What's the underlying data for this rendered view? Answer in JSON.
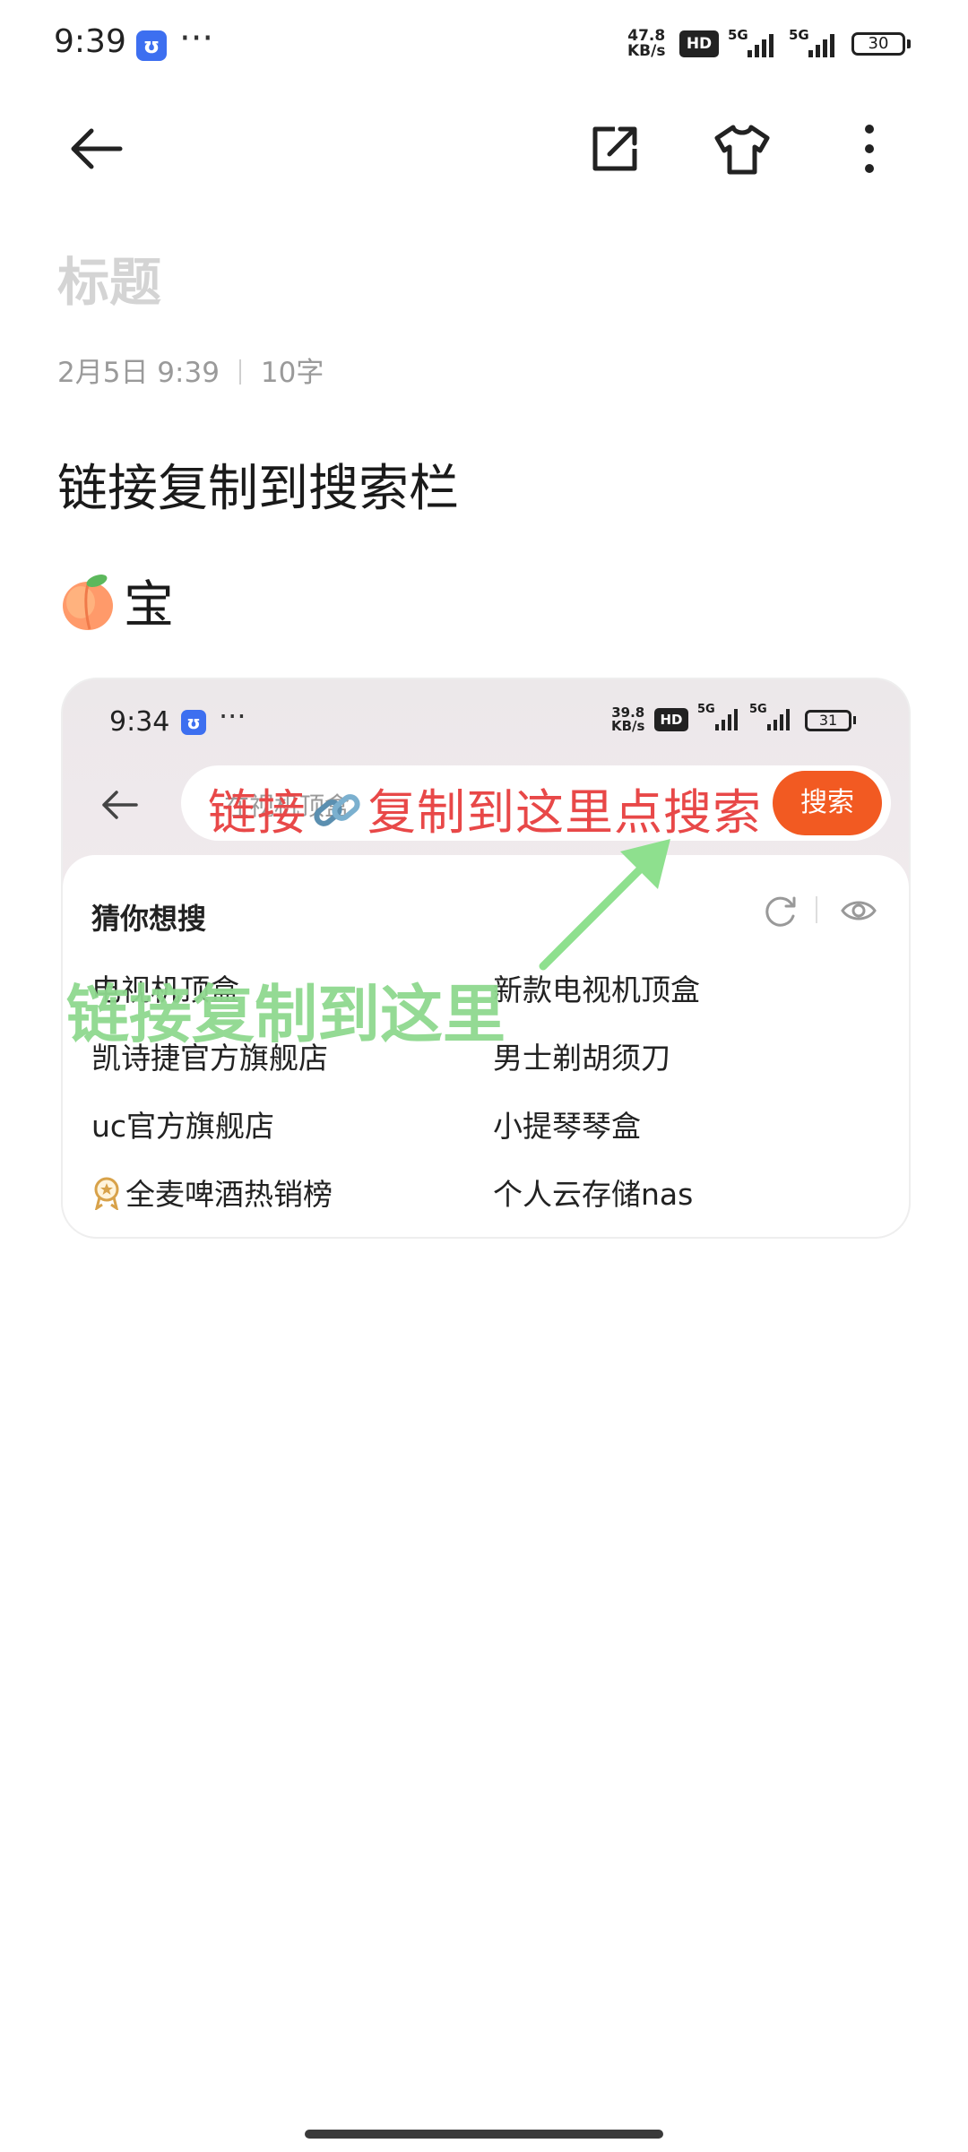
{
  "status_bar": {
    "time": "9:39",
    "net_speed_value": "47.8",
    "net_speed_unit": "KB/s",
    "hd_label": "HD",
    "net1": "5G",
    "net2": "5G",
    "battery": "30"
  },
  "toolbar": {
    "back_icon": "arrow-left-icon",
    "share_icon": "share-icon",
    "theme_icon": "tshirt-icon",
    "more_icon": "more-vertical-icon"
  },
  "note": {
    "title_placeholder": "标题",
    "date": "2月5日 9:39",
    "char_count": "10字",
    "line1": "链接复制到搜索栏",
    "line2_text": "宝"
  },
  "embedded_screenshot": {
    "time": "9:34",
    "net_speed_value": "39.8",
    "net_speed_unit": "KB/s",
    "hd_label": "HD",
    "net1": "5G",
    "net2": "5G",
    "battery": "31",
    "search_placeholder": "在视机顶盒",
    "search_button": "搜索",
    "guess_title": "猜你想搜",
    "items": [
      "电视机顶盒",
      "新款电视机顶盒",
      "凯诗捷官方旗舰店",
      "男士剃胡须刀",
      "uc官方旗舰店",
      "小提琴琴盒",
      "全麦啤酒热销榜",
      "个人云存储nas"
    ],
    "red_annotation_part1": "链接",
    "red_annotation_part2": "复制到这里点搜索",
    "green_annotation": "链接复制到这里",
    "colors": {
      "search_button": "#f25a22",
      "red_annotation": "#e84848",
      "green_annotation": "#8fd98f"
    }
  }
}
